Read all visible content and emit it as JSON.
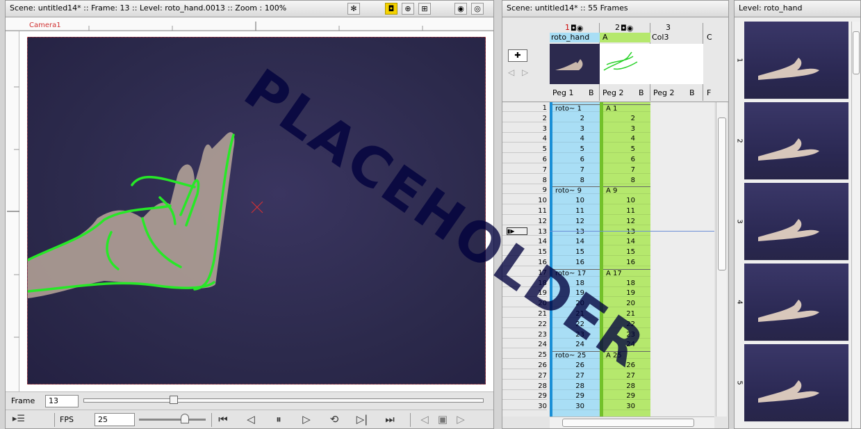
{
  "viewer": {
    "title": "Scene: untitled14*  ::  Frame: 13  ::  Level: roto_hand.0013  ::  Zoom : 100%",
    "camera_label": "Camera1",
    "frame_label": "Frame",
    "frame_value": "13",
    "fps_label": "FPS",
    "fps_value": "25"
  },
  "watermark": "PLACEHOLDER",
  "xsheet": {
    "title": "Scene: untitled14*  ::  55 Frames",
    "columns": [
      {
        "number": "1",
        "name": "roto_hand",
        "peg": "Peg 1",
        "b": "B"
      },
      {
        "number": "2",
        "name": "A",
        "peg": "Peg 2",
        "b": "B"
      },
      {
        "number": "3",
        "name": "Col3",
        "peg": "Peg 2",
        "b": "B"
      }
    ],
    "col4_initial": "C",
    "col4_peg": "F",
    "frames": [
      "1",
      "2",
      "3",
      "4",
      "5",
      "6",
      "7",
      "8",
      "9",
      "10",
      "11",
      "12",
      "13",
      "14",
      "15",
      "16",
      "17",
      "18",
      "19",
      "20",
      "21",
      "22",
      "23",
      "24",
      "25",
      "26",
      "27",
      "28",
      "29",
      "30"
    ],
    "col1_cells": [
      "roto~ 1",
      "2",
      "3",
      "4",
      "5",
      "6",
      "7",
      "8",
      "roto~ 9",
      "10",
      "11",
      "12",
      "13",
      "14",
      "15",
      "16",
      "roto~ 17",
      "18",
      "19",
      "20",
      "21",
      "22",
      "23",
      "24",
      "roto~ 25",
      "26",
      "27",
      "28",
      "29",
      "30"
    ],
    "col2_cells": [
      "A 1",
      "2",
      "3",
      "4",
      "5",
      "6",
      "7",
      "8",
      "A 9",
      "10",
      "11",
      "12",
      "13",
      "14",
      "15",
      "16",
      "A 17",
      "18",
      "19",
      "20",
      "21",
      "22",
      "23",
      "24",
      "A 25",
      "26",
      "27",
      "28",
      "29",
      "30"
    ]
  },
  "level_strip": {
    "title": "Level: roto_hand",
    "frames": [
      "1",
      "2",
      "3",
      "4",
      "5"
    ]
  }
}
